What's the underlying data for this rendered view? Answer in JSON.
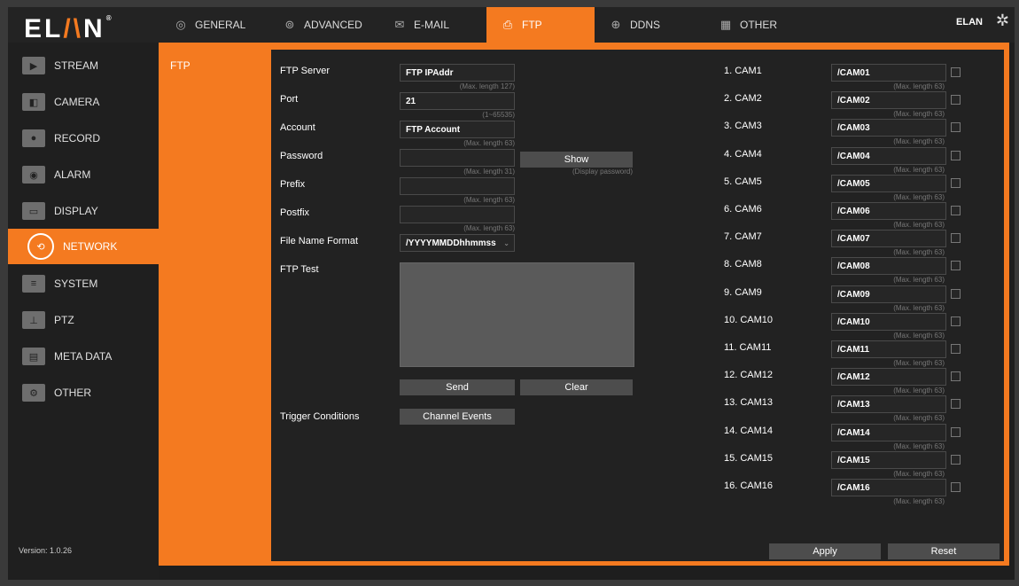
{
  "brand": {
    "logo_text_left": "EL",
    "logo_slash": "/\\",
    "logo_text_right": "N",
    "reg_mark": "®"
  },
  "topbar": {
    "tabs": [
      {
        "label": "GENERAL",
        "icon": "general-icon"
      },
      {
        "label": "ADVANCED",
        "icon": "advanced-icon"
      },
      {
        "label": "E-MAIL",
        "icon": "email-icon"
      },
      {
        "label": "FTP",
        "icon": "ftp-icon",
        "active": true
      },
      {
        "label": "DDNS",
        "icon": "ddns-icon"
      },
      {
        "label": "OTHER",
        "icon": "other-icon"
      }
    ],
    "user": "ELAN"
  },
  "sidebar": {
    "items": [
      {
        "label": "STREAM"
      },
      {
        "label": "CAMERA"
      },
      {
        "label": "RECORD"
      },
      {
        "label": "ALARM"
      },
      {
        "label": "DISPLAY"
      },
      {
        "label": "NETWORK",
        "active": true
      },
      {
        "label": "SYSTEM"
      },
      {
        "label": "PTZ"
      },
      {
        "label": "META DATA"
      },
      {
        "label": "OTHER"
      }
    ],
    "version": "Version: 1.0.26"
  },
  "subnav": {
    "item": "FTP"
  },
  "form": {
    "ftp_server": {
      "label": "FTP Server",
      "value": "FTP IPAddr",
      "hint": "(Max. length 127)"
    },
    "port": {
      "label": "Port",
      "value": "21",
      "hint": "(1~65535)"
    },
    "account": {
      "label": "Account",
      "value": "FTP Account",
      "hint": "(Max. length 63)"
    },
    "password": {
      "label": "Password",
      "value": "",
      "hint": "(Max. length 31)",
      "show_label": "Show",
      "show_hint": "(Display password)"
    },
    "prefix": {
      "label": "Prefix",
      "value": "",
      "hint": "(Max. length 63)"
    },
    "postfix": {
      "label": "Postfix",
      "value": "",
      "hint": "(Max. length 63)"
    },
    "file_name_format": {
      "label": "File Name Format",
      "value": "/YYYYMMDDhhmmss"
    },
    "ftp_test": {
      "label": "FTP Test",
      "send_label": "Send",
      "clear_label": "Clear"
    },
    "trigger": {
      "label": "Trigger Conditions",
      "button_label": "Channel Events"
    }
  },
  "cams": {
    "hint": "(Max. length 63)",
    "items": [
      {
        "label": "1. CAM1",
        "value": "/CAM01"
      },
      {
        "label": "2. CAM2",
        "value": "/CAM02"
      },
      {
        "label": "3. CAM3",
        "value": "/CAM03"
      },
      {
        "label": "4. CAM4",
        "value": "/CAM04"
      },
      {
        "label": "5. CAM5",
        "value": "/CAM05"
      },
      {
        "label": "6. CAM6",
        "value": "/CAM06"
      },
      {
        "label": "7. CAM7",
        "value": "/CAM07"
      },
      {
        "label": "8. CAM8",
        "value": "/CAM08"
      },
      {
        "label": "9. CAM9",
        "value": "/CAM09"
      },
      {
        "label": "10. CAM10",
        "value": "/CAM10"
      },
      {
        "label": "11. CAM11",
        "value": "/CAM11"
      },
      {
        "label": "12. CAM12",
        "value": "/CAM12"
      },
      {
        "label": "13. CAM13",
        "value": "/CAM13"
      },
      {
        "label": "14. CAM14",
        "value": "/CAM14"
      },
      {
        "label": "15. CAM15",
        "value": "/CAM15"
      },
      {
        "label": "16. CAM16",
        "value": "/CAM16"
      }
    ]
  },
  "actions": {
    "apply_label": "Apply",
    "reset_label": "Reset"
  },
  "colors": {
    "accent": "#f47a20",
    "background": "#222222"
  }
}
